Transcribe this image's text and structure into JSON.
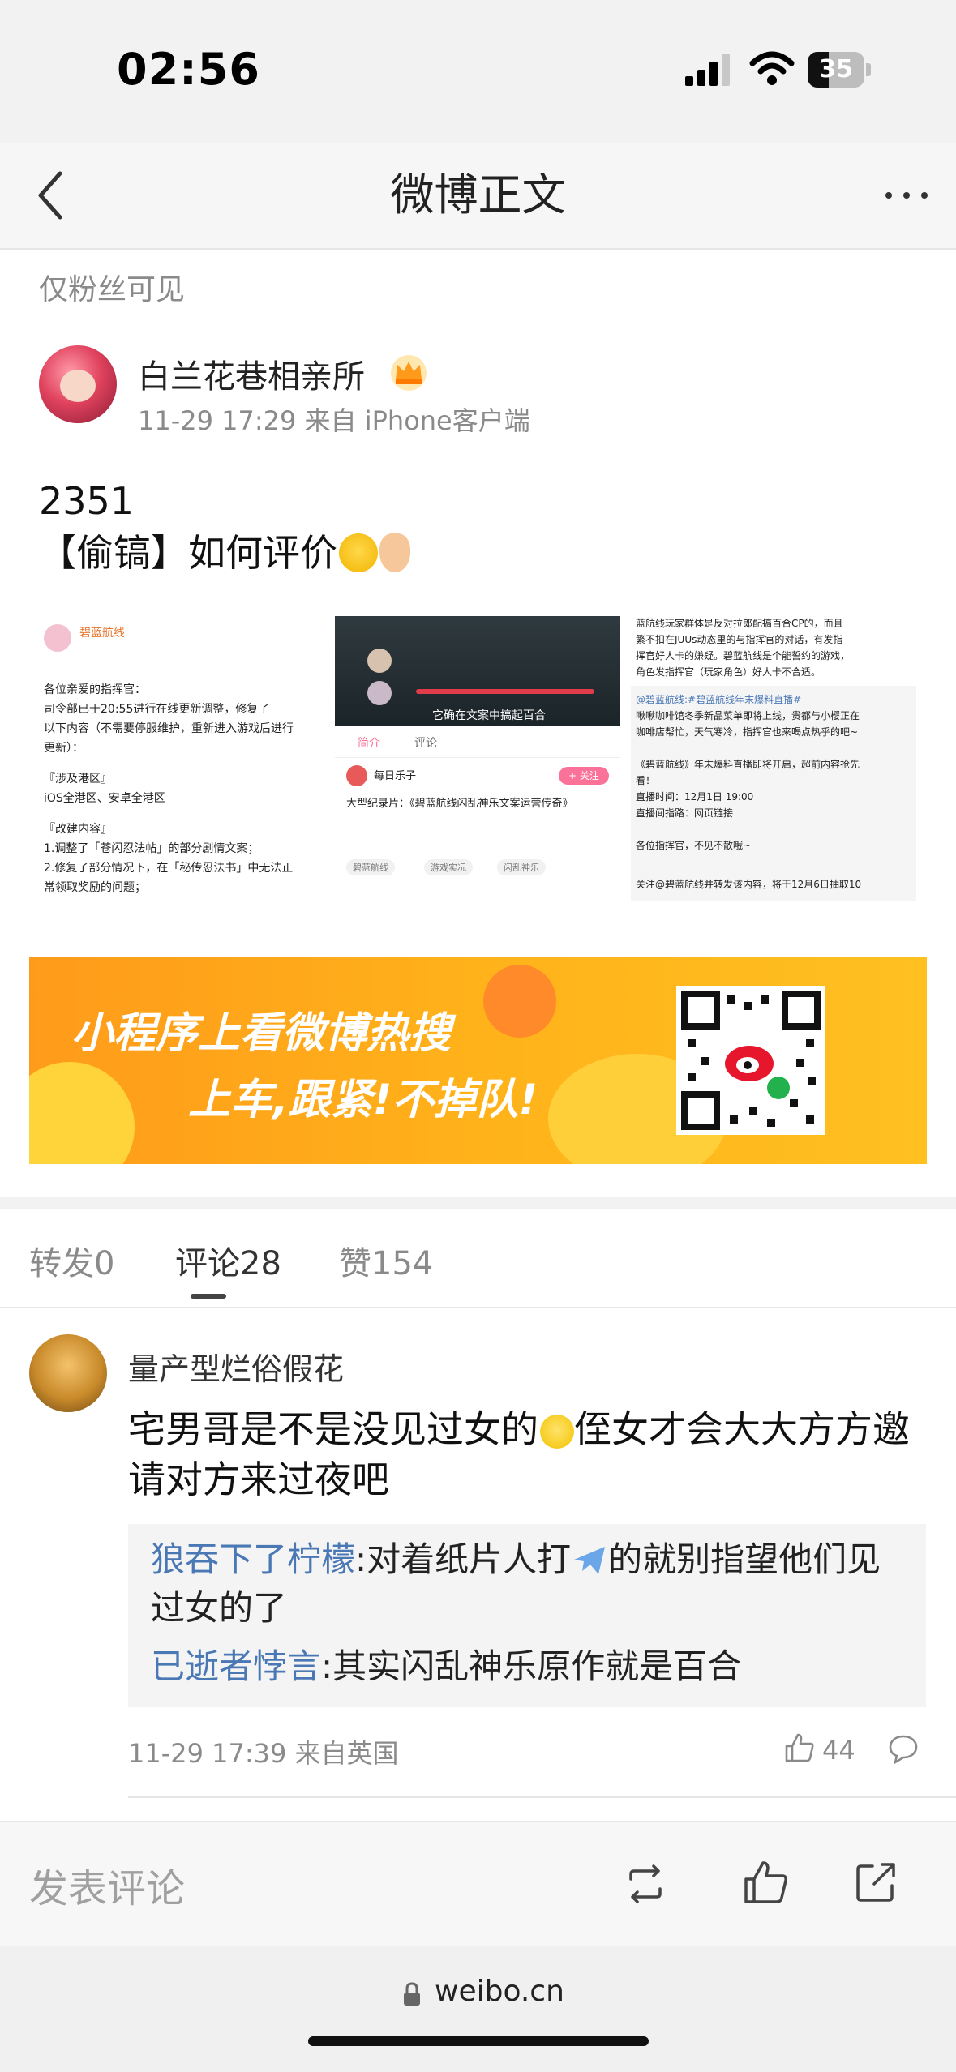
{
  "status": {
    "time": "02:56",
    "battery": "35"
  },
  "nav": {
    "title": "微博正文"
  },
  "post": {
    "visibility": "仅粉丝可见",
    "author": "白兰花巷相亲所",
    "meta": "11-29 17:29 来自 iPhone客户端",
    "line1": "2351",
    "line2": "【偷镐】如何评价",
    "images": {
      "img1": {
        "title": "碧蓝航线",
        "lines": [
          "各位亲爱的指挥官：",
          "司令部已于20:55进行在线更新调整，修复了",
          "以下内容（不需要停服维护，重新进入游戏后进行",
          "更新）：",
          "『涉及港区』",
          "iOS全港区、安卓全港区",
          "『改建内容』",
          "1.调整了「苍闪忍法帖」的部分剧情文案；",
          "2.修复了部分情况下，在「秘传忍法书」中无法正",
          "常领取奖励的问题；"
        ]
      },
      "img2": {
        "caption": "它确在文案中搞起百合",
        "tab1": "简介",
        "tab2": "评论",
        "user": "每日乐子",
        "follow": "+ 关注",
        "title": "大型纪录片：《碧蓝航线闪乱神乐文案运营传奇》",
        "tags": [
          "碧蓝航线",
          "游戏实况",
          "闪乱神乐"
        ]
      },
      "img3": {
        "lines": [
          "蓝航线玩家群体是反对拉郎配搞百合CP的，而且",
          "繁不扣在JUUs动态里的与指挥官的对话，有发指",
          "挥官好人卡的嫌疑。碧蓝航线是个能誓约的游戏，",
          "角色发指挥官（玩家角色）好人卡不合适。",
          "@碧蓝航线:#碧蓝航线年末爆料直播#",
          "啾啾咖啡馆冬季新品菜单即将上线，贵都与小樱正在",
          "咖啡店帮忙，天气寒冷，指挥官也来喝点热乎的吧~",
          "《碧蓝航线》年末爆料直播即将开启，超前内容抢先",
          "看！",
          "直播时间：12月1日 19:00",
          "直播间指路：网页链接",
          "各位指挥官，不见不散哦~",
          "关注@碧蓝航线并转发该内容，将于12月6日抽取10"
        ]
      }
    }
  },
  "banner": {
    "line1": "小程序上看微博热搜",
    "line2": "上车,跟紧!不掉队!"
  },
  "tabs": {
    "repost": "转发0",
    "comment": "评论28",
    "like": "赞154"
  },
  "comment": {
    "user": "量产型烂俗假花",
    "text_a": "宅男哥是不是没见过女的",
    "text_b": "侄女才会大大方方邀请对方来过夜吧",
    "replies": [
      {
        "name": "狼吞下了柠檬",
        "text_a": ":对着纸片人打",
        "text_b": "的就别指望他们见过女的了"
      },
      {
        "name": "已逝者悖言",
        "text": ":其实闪乱神乐原作就是百合"
      }
    ],
    "meta": "11-29 17:39 来自英国",
    "likes": "44"
  },
  "toolbar": {
    "placeholder": "发表评论"
  },
  "browser": {
    "url": "weibo.cn"
  },
  "colors": {
    "link": "#4a78b5",
    "accent_orange": "#ff8200",
    "banner_yellow": "#ffb21a"
  }
}
